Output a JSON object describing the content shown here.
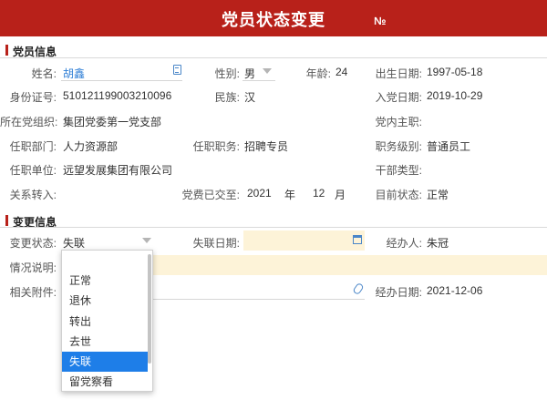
{
  "header": {
    "title": "党员状态变更",
    "no_label": "№"
  },
  "member_section": {
    "title": "党员信息",
    "name_label": "姓名:",
    "name_value": "胡鑫",
    "gender_label": "性别:",
    "gender_value": "男",
    "age_label": "年龄:",
    "age_value": "24",
    "birth_label": "出生日期:",
    "birth_value": "1997-05-18",
    "id_label": "身份证号:",
    "id_value": "510121199003210096",
    "ethnic_label": "民族:",
    "ethnic_value": "汉",
    "join_label": "入党日期:",
    "join_value": "2019-10-29",
    "org_label": "所在党组织:",
    "org_value": "集团党委第一党支部",
    "duty_label": "党内主职:",
    "duty_value": "",
    "dept_label": "任职部门:",
    "dept_value": "人力资源部",
    "position_label": "任职职务:",
    "position_value": "招聘专员",
    "level_label": "职务级别:",
    "level_value": "普通员工",
    "unit_label": "任职单位:",
    "unit_value": "远望发展集团有限公司",
    "cadre_label": "干部类型:",
    "cadre_value": "",
    "transfer_label": "关系转入:",
    "transfer_value": "",
    "fee_label": "党费已交至:",
    "fee_year": "2021",
    "fee_year_unit": "年",
    "fee_month": "12",
    "fee_month_unit": "月",
    "status_label": "目前状态:",
    "status_value": "正常"
  },
  "change_section": {
    "title": "变更信息",
    "change_status_label": "变更状态:",
    "change_status_value": "失联",
    "lost_date_label": "失联日期:",
    "lost_date_value": "",
    "handler_label": "经办人:",
    "handler_value": "朱冠",
    "desc_label": "情况说明:",
    "attach_label": "相关附件:",
    "handle_date_label": "经办日期:",
    "handle_date_value": "2021-12-06"
  },
  "dropdown": {
    "options": [
      "正常",
      "退休",
      "转出",
      "去世",
      "失联",
      "留党察看"
    ],
    "selected": "失联"
  },
  "colors": {
    "header": "#b8211a",
    "accent": "#1e7ee8",
    "highlight_field": "#fdf3d8"
  }
}
